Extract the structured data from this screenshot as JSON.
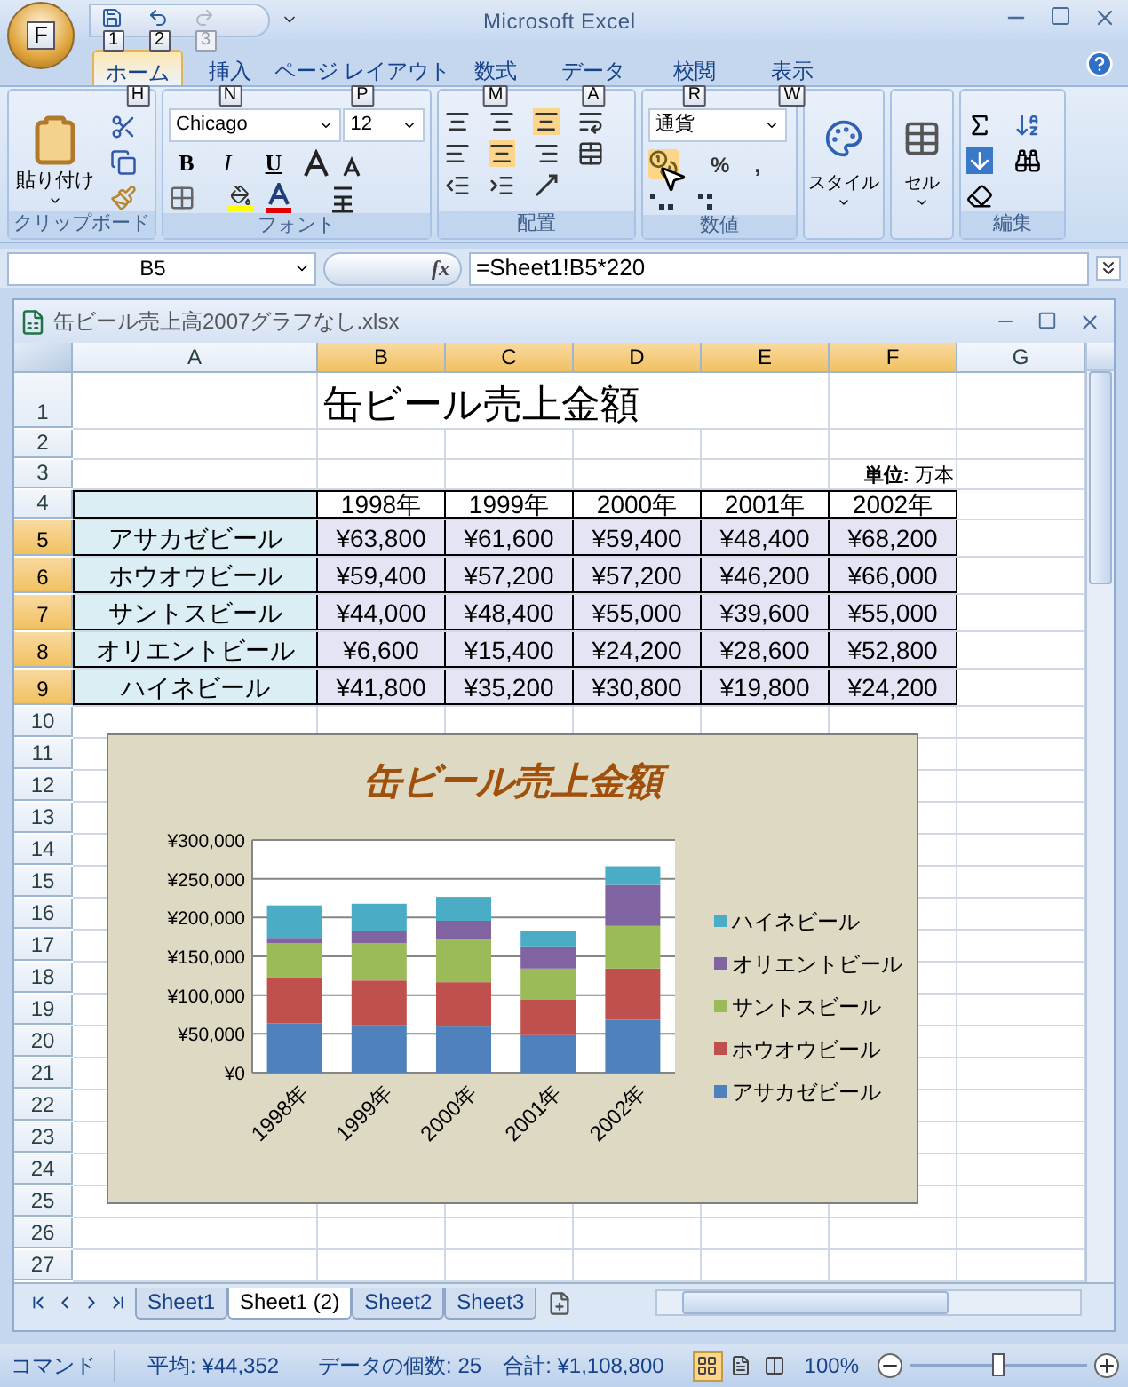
{
  "window": {
    "title": "Microsoft Excel"
  },
  "office_button": {
    "keytip": "F"
  },
  "quick_access": [
    {
      "kind": "save",
      "keytip": "1",
      "disabled": false
    },
    {
      "kind": "undo",
      "keytip": "2",
      "disabled": false
    },
    {
      "kind": "redo",
      "keytip": "3",
      "disabled": true
    }
  ],
  "ribbon_tabs": [
    {
      "label": "ホーム",
      "keytip": "H",
      "selected": true
    },
    {
      "label": "挿入",
      "keytip": "N",
      "selected": false
    },
    {
      "label": "ページ レイアウト",
      "keytip": "P",
      "selected": false
    },
    {
      "label": "数式",
      "keytip": "M",
      "selected": false
    },
    {
      "label": "データ",
      "keytip": "A",
      "selected": false
    },
    {
      "label": "校閲",
      "keytip": "R",
      "selected": false
    },
    {
      "label": "表示",
      "keytip": "W",
      "selected": false
    }
  ],
  "ribbon": {
    "clipboard": {
      "label": "クリップボード",
      "paste": "貼り付け"
    },
    "font": {
      "label": "フォント",
      "font_name": "Chicago",
      "font_size": "12",
      "bold": "B",
      "italic": "I",
      "underline": "U"
    },
    "alignment": {
      "label": "配置"
    },
    "number": {
      "label": "数値",
      "format": "通貨",
      "percent": "%",
      "comma": ","
    },
    "styles": {
      "button": "スタイル"
    },
    "cells": {
      "button": "セル"
    },
    "editing": {
      "label": "編集"
    }
  },
  "formula_bar": {
    "name_box": "B5",
    "fx": "fx",
    "formula": "=Sheet1!B5*220"
  },
  "workbook": {
    "title": "缶ビール売上高2007グラフなし.xlsx"
  },
  "columns": [
    {
      "label": "A",
      "selected": false
    },
    {
      "label": "B",
      "selected": true
    },
    {
      "label": "C",
      "selected": true
    },
    {
      "label": "D",
      "selected": true
    },
    {
      "label": "E",
      "selected": true
    },
    {
      "label": "F",
      "selected": true
    },
    {
      "label": "G",
      "selected": false
    }
  ],
  "row_numbers": [
    {
      "label": "1",
      "selected": false
    },
    {
      "label": "2",
      "selected": false
    },
    {
      "label": "3",
      "selected": false
    },
    {
      "label": "4",
      "selected": false
    },
    {
      "label": "5",
      "selected": true
    },
    {
      "label": "6",
      "selected": true
    },
    {
      "label": "7",
      "selected": true
    },
    {
      "label": "8",
      "selected": true
    },
    {
      "label": "9",
      "selected": true
    },
    {
      "label": "10",
      "selected": false
    },
    {
      "label": "11",
      "selected": false
    },
    {
      "label": "12",
      "selected": false
    },
    {
      "label": "13",
      "selected": false
    },
    {
      "label": "14",
      "selected": false
    },
    {
      "label": "15",
      "selected": false
    },
    {
      "label": "16",
      "selected": false
    },
    {
      "label": "17",
      "selected": false
    },
    {
      "label": "18",
      "selected": false
    },
    {
      "label": "19",
      "selected": false
    },
    {
      "label": "20",
      "selected": false
    },
    {
      "label": "21",
      "selected": false
    },
    {
      "label": "22",
      "selected": false
    },
    {
      "label": "23",
      "selected": false
    },
    {
      "label": "24",
      "selected": false
    },
    {
      "label": "25",
      "selected": false
    },
    {
      "label": "26",
      "selected": false
    },
    {
      "label": "27",
      "selected": false
    }
  ],
  "sheet": {
    "title": "缶ビール売上金額",
    "unit": "**単位:** 万本",
    "selected": true,
    "years": [
      "1998年",
      "1999年",
      "2000年",
      "2001年",
      "2002年"
    ],
    "rows": [
      {
        "name": "アサカゼビール",
        "values": [
          "¥63,800",
          "¥61,600",
          "¥59,400",
          "¥48,400",
          "¥68,200"
        ]
      },
      {
        "name": "ホウオウビール",
        "values": [
          "¥59,400",
          "¥57,200",
          "¥57,200",
          "¥46,200",
          "¥66,000"
        ]
      },
      {
        "name": "サントスビール",
        "values": [
          "¥44,000",
          "¥48,400",
          "¥55,000",
          "¥39,600",
          "¥55,000"
        ]
      },
      {
        "name": "オリエントビール",
        "values": [
          "¥6,600",
          "¥15,400",
          "¥24,200",
          "¥28,600",
          "¥52,800"
        ]
      },
      {
        "name": "ハイネビール",
        "values": [
          "¥41,800",
          "¥35,200",
          "¥30,800",
          "¥19,800",
          "¥24,200"
        ]
      }
    ]
  },
  "chart": {
    "chart_data": {
      "type": "bar",
      "title": "缶ビール売上金額",
      "stacked": true,
      "grid": true,
      "legend": "right",
      "categories": [
        "1998年",
        "1999年",
        "2000年",
        "2001年",
        "2002年"
      ],
      "series": [
        {
          "name": "アサカゼビール",
          "color": "#4f81bd",
          "values": [
            63800,
            61600,
            59400,
            48400,
            68200
          ]
        },
        {
          "name": "ホウオウビール",
          "color": "#c0504d",
          "values": [
            59400,
            57200,
            57200,
            46200,
            66000
          ]
        },
        {
          "name": "サントスビール",
          "color": "#9bbb59",
          "values": [
            44000,
            48400,
            55000,
            39600,
            55000
          ]
        },
        {
          "name": "オリエントビール",
          "color": "#8064a2",
          "values": [
            6600,
            15400,
            24200,
            28600,
            52800
          ]
        },
        {
          "name": "ハイネビール",
          "color": "#4bacc6",
          "values": [
            41800,
            35200,
            30800,
            19800,
            24200
          ]
        }
      ],
      "ylim": [
        0,
        300000
      ],
      "yticks": [
        {
          "value": 0,
          "label": "¥0"
        },
        {
          "value": 50000,
          "label": "¥50,000"
        },
        {
          "value": 100000,
          "label": "¥100,000"
        },
        {
          "value": 150000,
          "label": "¥150,000"
        },
        {
          "value": 200000,
          "label": "¥200,000"
        },
        {
          "value": 250000,
          "label": "¥250,000"
        },
        {
          "value": 300000,
          "label": "¥300,000"
        }
      ]
    }
  },
  "sheet_tabs": [
    {
      "label": "Sheet1",
      "selected": false
    },
    {
      "label": "Sheet1 (2)",
      "selected": true
    },
    {
      "label": "Sheet2",
      "selected": false
    },
    {
      "label": "Sheet3",
      "selected": false
    }
  ],
  "status_bar": {
    "mode": "コマンド",
    "average": "平均: ¥44,352",
    "count": "データの個数: 25",
    "sum": "合計: ¥1,108,800",
    "views": [
      {
        "kind": "normal",
        "selected": true
      },
      {
        "kind": "page_layout",
        "selected": false
      },
      {
        "kind": "page_break",
        "selected": false
      }
    ],
    "zoom": "100%",
    "zoom_slider": {
      "level": 0.5
    }
  }
}
